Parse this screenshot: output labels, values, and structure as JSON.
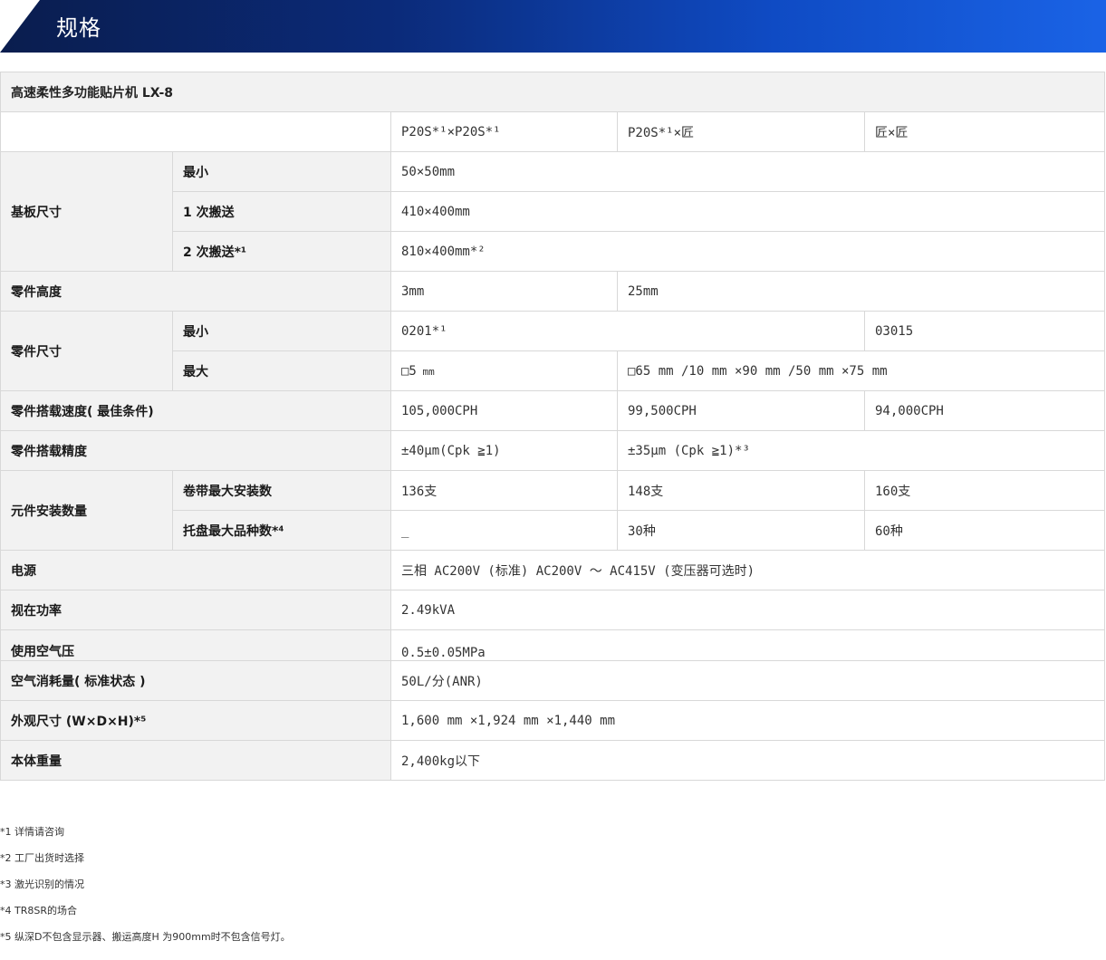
{
  "header": {
    "title": "规格"
  },
  "table": {
    "title": "高速柔性多功能贴片机 LX-8",
    "columns": [
      "P20S*¹×P20S*¹",
      "P20S*¹×匠",
      "匠×匠"
    ],
    "board_size": {
      "label": "基板尺寸",
      "min_label": "最小",
      "min_value": "50×50mm",
      "single_label": "1 次搬送",
      "single_value": "410×400mm",
      "double_label": "2 次搬送*¹",
      "double_value": "810×400mm*²"
    },
    "part_height": {
      "label": "零件高度",
      "v1": "3mm",
      "v2": "25mm"
    },
    "part_size": {
      "label": "零件尺寸",
      "min_label": "最小",
      "min_v1": "0201*¹",
      "min_v3": "03015",
      "max_label": "最大",
      "max_v1_a": "□5",
      "max_v1_b": " mm",
      "max_v2": "□65 mm /10 mm ×90 mm /50 mm ×75 mm"
    },
    "speed": {
      "label": "零件搭载速度( 最佳条件)",
      "v1": "105,000CPH",
      "v2": "99,500CPH",
      "v3": "94,000CPH"
    },
    "accuracy": {
      "label": "零件搭载精度",
      "v1": "±40μm(Cpk ≧1)",
      "v2": "±35μm (Cpk ≧1)*³"
    },
    "install": {
      "label": "元件安装数量",
      "tape_label": "卷带最大安装数",
      "tape_v1": "136支",
      "tape_v2": "148支",
      "tape_v3": "160支",
      "tray_label": "托盘最大品种数*⁴",
      "tray_v1": "_",
      "tray_v2": "30种",
      "tray_v3": "60种"
    },
    "power": {
      "label": "电源",
      "value": "三相 AC200V (标准) AC200V ～ AC415V (变压器可选时)"
    },
    "apparent_power": {
      "label": "视在功率",
      "value": "2.49kVA"
    },
    "air_pressure": {
      "label": "使用空气压",
      "value": "0.5±0.05MPa"
    },
    "air_consumption": {
      "label": "空气消耗量( 标准状态 )",
      "value": "50L/分(ANR)"
    },
    "dimensions": {
      "label": "外观尺寸 (W×D×H)*⁵",
      "value": "1,600 mm ×1,924 mm ×1,440 mm"
    },
    "weight": {
      "label": "本体重量",
      "value": "2,400kg以下"
    }
  },
  "notes": [
    "*1 详情请咨询",
    "*2 工厂出货时选择",
    "*3 激光识别的情况",
    "*4 TR8SR的场合",
    "*5 纵深D不包含显示器、搬运高度H 为900mm时不包含信号灯。"
  ]
}
